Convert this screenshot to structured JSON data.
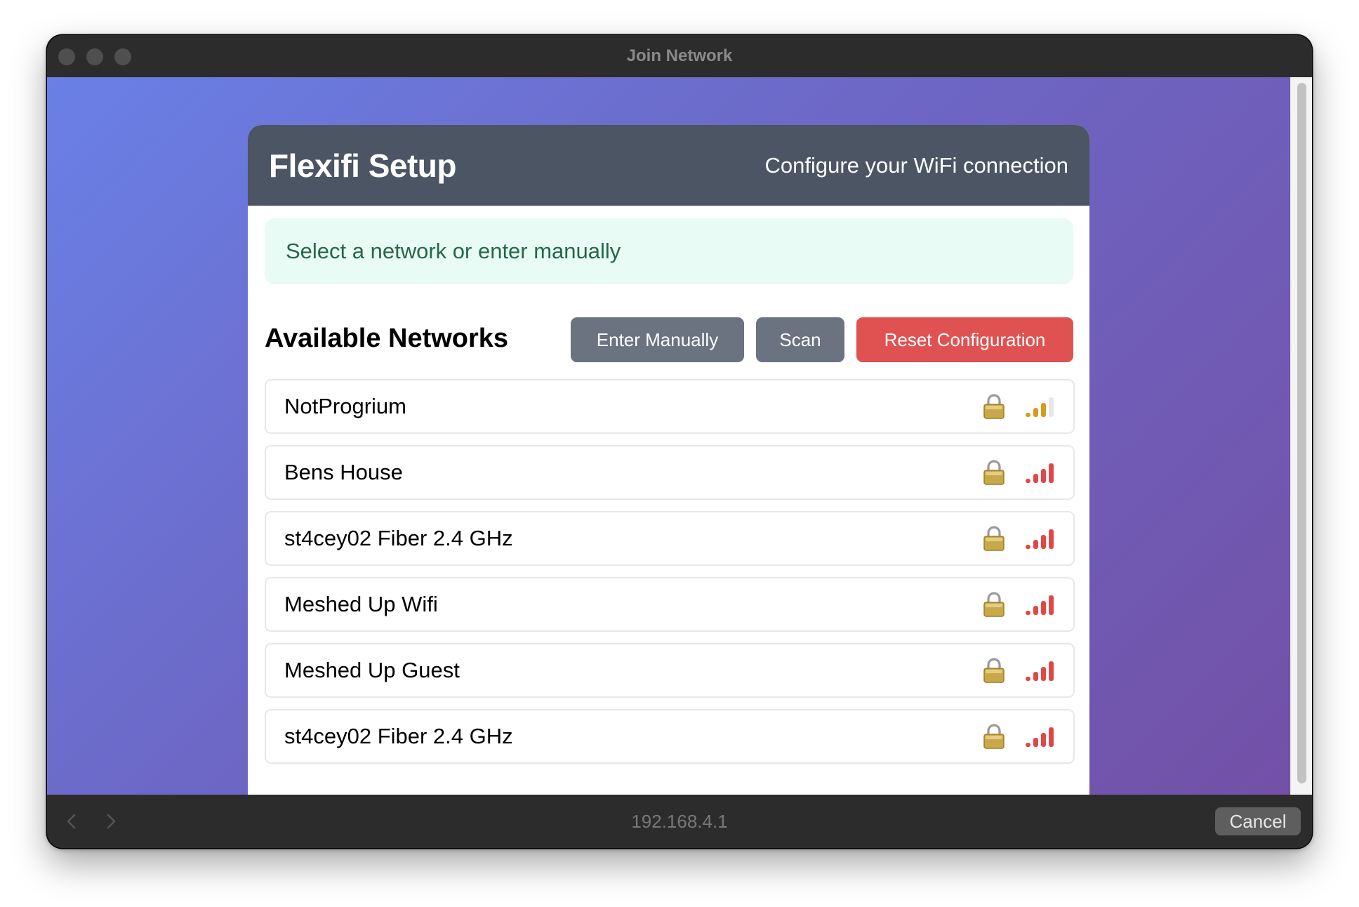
{
  "window": {
    "title": "Join Network"
  },
  "setup": {
    "title": "Flexifi Setup",
    "subtitle": "Configure your WiFi connection",
    "notice": "Select a network or enter manually",
    "section_title": "Available Networks",
    "buttons": {
      "enter_manually": "Enter Manually",
      "scan": "Scan",
      "reset": "Reset Configuration"
    }
  },
  "networks": [
    {
      "ssid": "NotProgrium",
      "secured": true,
      "signal_bars": 3,
      "icons": [
        "lock-icon",
        "signal-icon"
      ]
    },
    {
      "ssid": "Bens House",
      "secured": true,
      "signal_bars": 4,
      "icons": [
        "lock-icon",
        "signal-icon"
      ]
    },
    {
      "ssid": "st4cey02 Fiber 2.4 GHz",
      "secured": true,
      "signal_bars": 4,
      "icons": [
        "lock-icon",
        "signal-icon"
      ]
    },
    {
      "ssid": "Meshed Up Wifi",
      "secured": true,
      "signal_bars": 4,
      "icons": [
        "lock-icon",
        "signal-icon"
      ]
    },
    {
      "ssid": "Meshed Up Guest",
      "secured": true,
      "signal_bars": 4,
      "icons": [
        "lock-icon",
        "signal-icon"
      ]
    },
    {
      "ssid": "st4cey02 Fiber 2.4 GHz",
      "secured": true,
      "signal_bars": 4,
      "icons": [
        "lock-icon",
        "signal-icon"
      ]
    }
  ],
  "colors": {
    "header_bg": "#4b5563",
    "notice_bg": "#e8fbf5",
    "notice_text": "#276749",
    "gray_button": "#6b7280",
    "danger_button": "#e05252",
    "signal_strong": "#e04848",
    "signal_medium": "#d69a1f",
    "signal_empty": "#e5e7eb"
  },
  "bottom_bar": {
    "address": "192.168.4.1",
    "cancel_label": "Cancel"
  }
}
